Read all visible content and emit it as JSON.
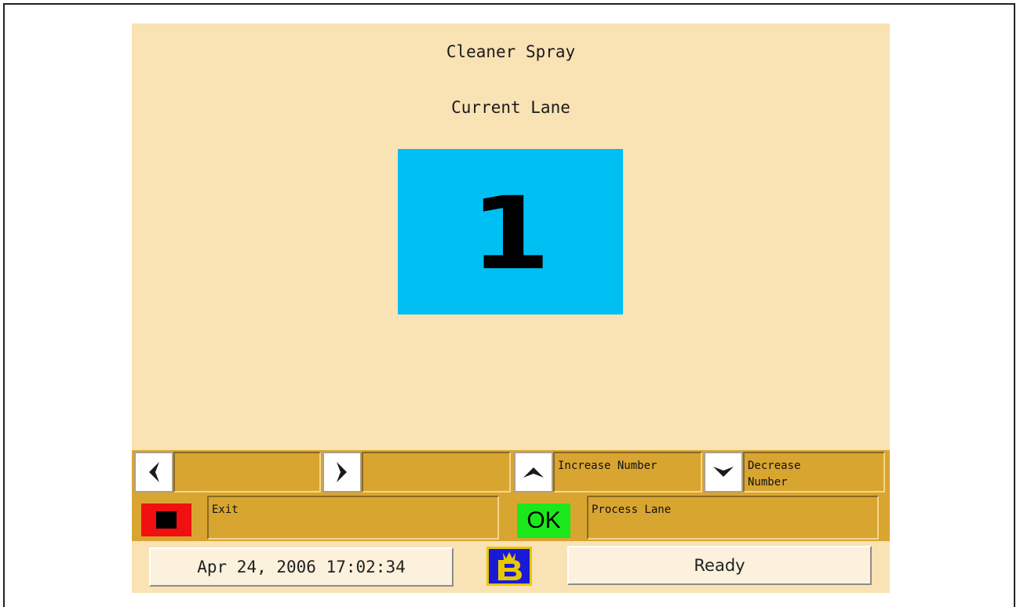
{
  "screen": {
    "title": "Cleaner Spray",
    "subtitle": "Current Lane",
    "lane_number": "1"
  },
  "keys": {
    "left_label": "",
    "right_label": "",
    "increase_label": "Increase Number",
    "decrease_label": "Decrease\nNumber",
    "exit_label": "Exit",
    "ok_label": "OK",
    "process_label": "Process Lane"
  },
  "status_bar": {
    "datetime": "Apr 24, 2006 17:02:34",
    "status": "Ready"
  },
  "colors": {
    "background": "#f9e2b4",
    "lane_box": "#00bff3",
    "key_bar": "#d9a531",
    "exit_button": "#f01010",
    "ok_button": "#1be81b"
  },
  "icons": {
    "left": "chevron-left-icon",
    "right": "chevron-right-icon",
    "up": "chevron-up-icon",
    "down": "chevron-down-icon",
    "stop": "stop-icon",
    "logo": "brand-logo-icon"
  }
}
